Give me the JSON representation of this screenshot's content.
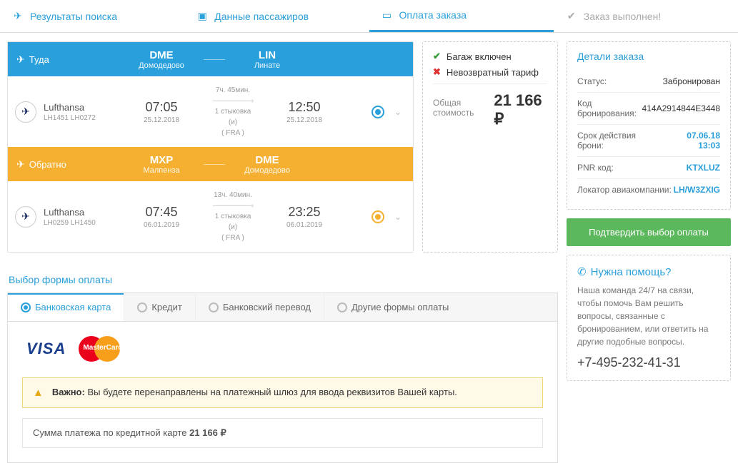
{
  "steps": {
    "search": "Результаты поиска",
    "passengers": "Данные пассажиров",
    "payment": "Оплата заказа",
    "done": "Заказ выполнен!"
  },
  "outbound": {
    "dir": "Туда",
    "from_code": "DME",
    "from_name": "Домодедово",
    "to_code": "LIN",
    "to_name": "Линате",
    "airline": "Lufthansa",
    "flights": "LH1451  LH0272",
    "dep_time": "07:05",
    "dep_date": "25.12.2018",
    "arr_time": "12:50",
    "arr_date": "25.12.2018",
    "duration": "7ч. 45мин.",
    "stops": "1 стыковка",
    "via_and": "(и)",
    "via": "( FRA )"
  },
  "rtn": {
    "dir": "Обратно",
    "from_code": "MXP",
    "from_name": "Малпенза",
    "to_code": "DME",
    "to_name": "Домодедово",
    "airline": "Lufthansa",
    "flights": "LH0259  LH1450",
    "dep_time": "07:45",
    "dep_date": "06.01.2019",
    "arr_time": "23:25",
    "arr_date": "06.01.2019",
    "duration": "13ч. 40мин.",
    "stops": "1 стыковка",
    "via_and": "(и)",
    "via": "( FRA )"
  },
  "summary": {
    "baggage": "Багаж включен",
    "refund": "Невозвратный тариф",
    "total_label": "Общая стоимость",
    "total": "21 166",
    "currency": "₽"
  },
  "payform": {
    "title": "Выбор формы оплаты",
    "tabs": {
      "card": "Банковская карта",
      "credit": "Кредит",
      "bank": "Банковский перевод",
      "other": "Другие формы оплаты"
    },
    "visa": "VISA",
    "mastercard": "MasterCard",
    "alert_strong": "Важно:",
    "alert_text": "Вы будете перенаправлены на платежный шлюз для ввода реквизитов Вашей карты.",
    "pay_label": "Сумма платежа по кредитной карте",
    "pay_amount": "21 166",
    "pay_currency": "₽"
  },
  "details": {
    "title": "Детали заказа",
    "status_k": "Статус:",
    "status_v": "Забронирован",
    "code_k": "Код бронирования:",
    "code_v": "414A2914844E3448",
    "expire_k": "Срок действия брони:",
    "expire_v": "07.06.18 13:03",
    "pnr_k": "PNR код:",
    "pnr_v": "KTXLUZ",
    "locator_k": "Локатор авиакомпании:",
    "locator_v": "LH/W3ZXIG"
  },
  "confirm": "Подтвердить выбор оплаты",
  "help": {
    "title": "Нужна помощь?",
    "text": "Наша команда 24/7 на связи, чтобы помочь Вам решить вопросы, связанные с бронированием, или ответить на другие подобные вопросы.",
    "phone": "+7-495-232-41-31"
  }
}
